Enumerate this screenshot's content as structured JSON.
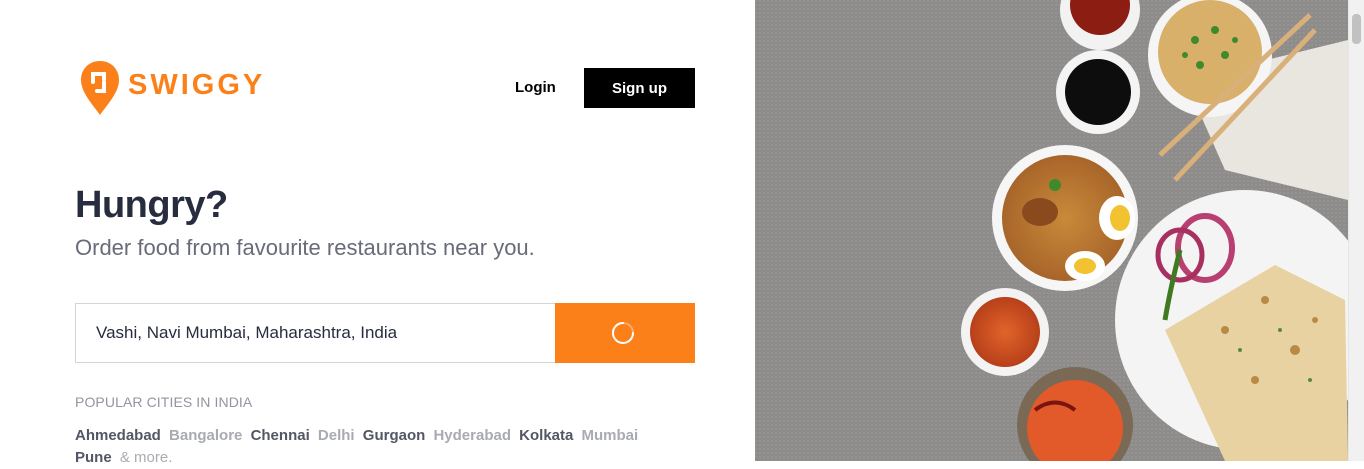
{
  "brand": {
    "name": "SWIGGY",
    "logo_icon": "swiggy-pin-logo-icon",
    "color": "#fc8019"
  },
  "header": {
    "login_label": "Login",
    "signup_label": "Sign up"
  },
  "hero": {
    "title": "Hungry?",
    "subtitle": "Order food from favourite restaurants near you."
  },
  "search": {
    "value": "Vashi, Navi Mumbai, Maharashtra, India",
    "button_state": "loading",
    "button_icon": "loading-spinner-icon"
  },
  "cities": {
    "label": "POPULAR CITIES IN INDIA",
    "items": [
      {
        "name": "Ahmedabad",
        "tone": "dark"
      },
      {
        "name": "Bangalore",
        "tone": "light"
      },
      {
        "name": "Chennai",
        "tone": "dark"
      },
      {
        "name": "Delhi",
        "tone": "light"
      },
      {
        "name": "Gurgaon",
        "tone": "dark"
      },
      {
        "name": "Hyderabad",
        "tone": "light"
      },
      {
        "name": "Kolkata",
        "tone": "dark"
      },
      {
        "name": "Mumbai",
        "tone": "light"
      },
      {
        "name": "Pune",
        "tone": "dark"
      }
    ],
    "more_label": "& more."
  },
  "colors": {
    "accent": "#fc8019",
    "heading": "#282c3f",
    "subtext": "#686b78"
  }
}
